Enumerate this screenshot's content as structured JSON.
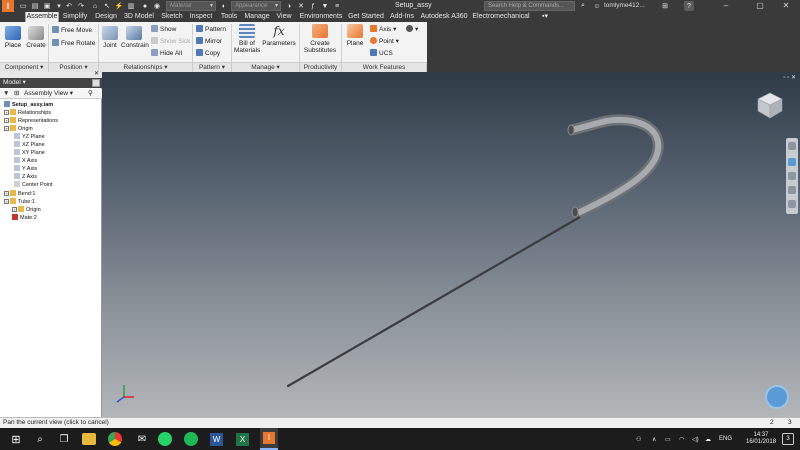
{
  "window": {
    "title": "Setup_assy",
    "material_placeholder": "Material",
    "appearance_placeholder": "Appearance",
    "search_placeholder": "Search Help & Commands...",
    "user": "tomlyme412...",
    "help": "?"
  },
  "tabs": [
    "Assemble",
    "Simplify",
    "Design",
    "3D Model",
    "Sketch",
    "Inspect",
    "Tools",
    "Manage",
    "View",
    "Environments",
    "Get Started",
    "Add-Ins",
    "Autodesk A360",
    "Electromechanical"
  ],
  "ribbon": {
    "place": "Place",
    "create": "Create",
    "free_move": "Free Move",
    "free_rotate": "Free Rotate",
    "joint": "Joint",
    "constrain": "Constrain",
    "show": "Show",
    "show_sick": "Show Sick",
    "hide_all": "Hide All",
    "pattern": "Pattern",
    "mirror": "Mirror",
    "copy": "Copy",
    "bill_line1": "Bill of",
    "bill_line2": "Materials",
    "parameters": "Parameters",
    "create_subst_line1": "Create",
    "create_subst_line2": "Substitutes",
    "plane": "Plane",
    "axis": "Axis",
    "point": "Point",
    "ucs": "UCS",
    "groups": {
      "component": "Component",
      "position": "Position",
      "relationships": "Relationships",
      "pattern": "Pattern",
      "manage": "Manage",
      "productivity": "Productivity",
      "work_features": "Work Features"
    }
  },
  "browser": {
    "header": "Model",
    "view": "Assembly View",
    "nodes": [
      {
        "label": "Setup_assy.iam",
        "bold": true
      },
      {
        "label": "Relationships"
      },
      {
        "label": "Representations"
      },
      {
        "label": "Origin"
      },
      {
        "label": "YZ Plane"
      },
      {
        "label": "XZ Plane"
      },
      {
        "label": "XY Plane"
      },
      {
        "label": "X Axis"
      },
      {
        "label": "Y Axis"
      },
      {
        "label": "Z Axis"
      },
      {
        "label": "Center Point"
      },
      {
        "label": "Bend:1"
      },
      {
        "label": "Tube:1"
      },
      {
        "label": "Origin"
      },
      {
        "label": "Mate:2"
      }
    ]
  },
  "status": {
    "message": "Pan the current view (click to cancel)",
    "count1": "2",
    "count2": "3"
  },
  "taskbar": {
    "lang": "ENG",
    "time": "14:37",
    "date": "16/01/2018",
    "notifications": "3"
  },
  "colors": {
    "title_bar": "#3a3a3a",
    "ribbon_bg": "#f3f3f3",
    "accent_orange": "#e8772e",
    "accent_blue": "#3b7bd0"
  }
}
